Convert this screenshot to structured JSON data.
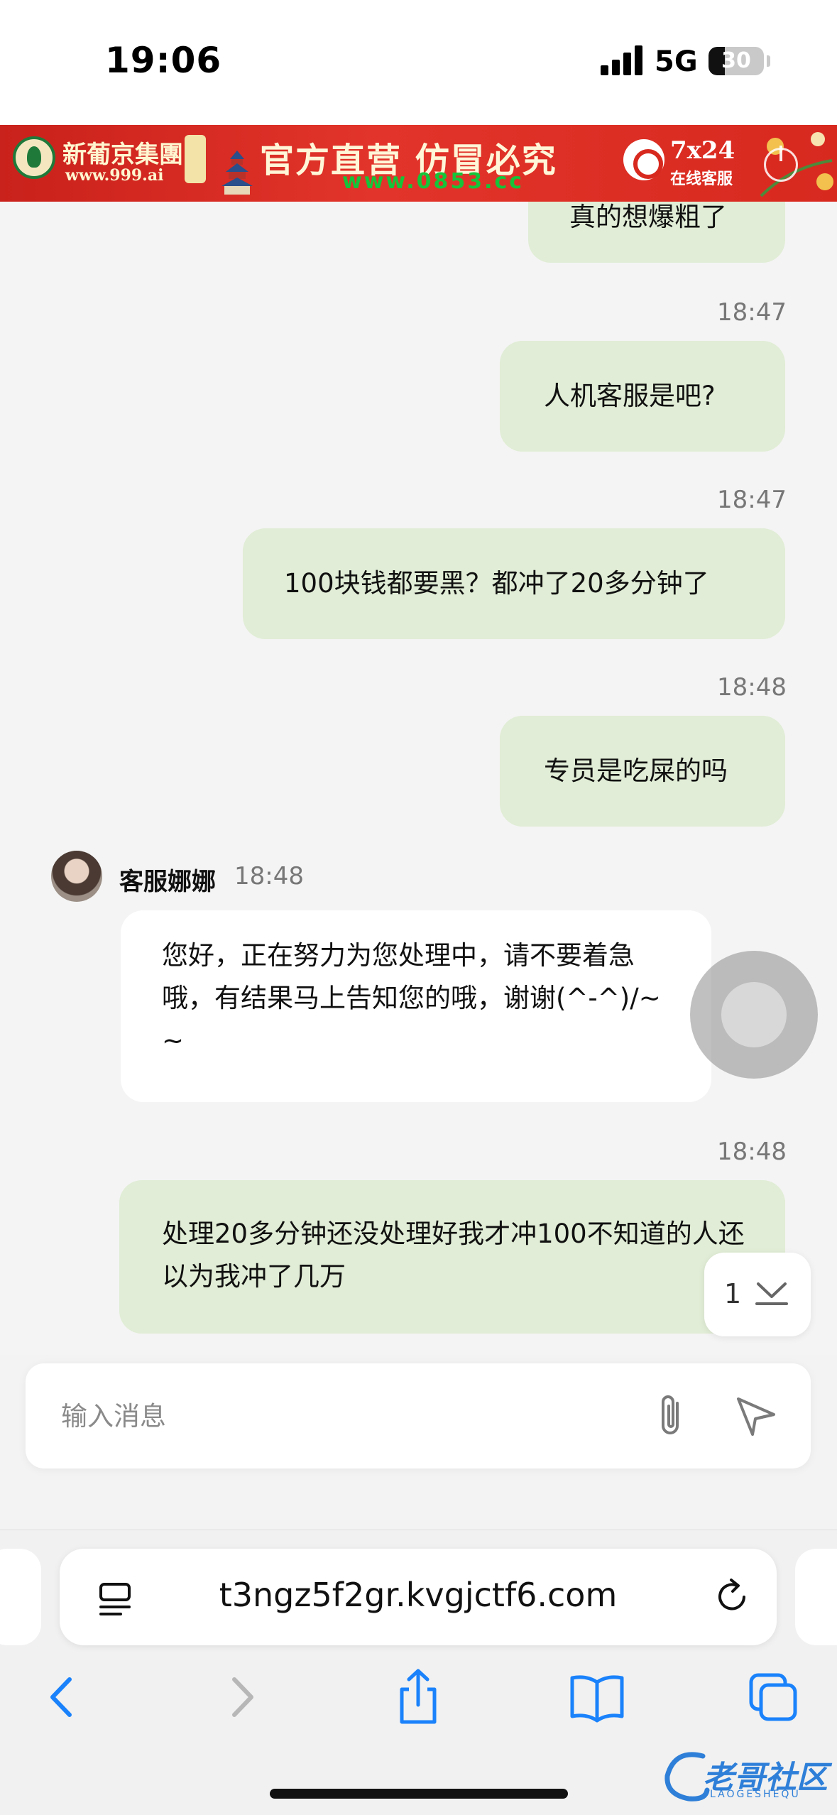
{
  "status_bar": {
    "time": "19:06",
    "network": "5G",
    "battery": "30",
    "battery_level": 0.3
  },
  "ad": {
    "brand": "新葡京集團",
    "brand_url": "www.999.ai",
    "slogan": "官方直营  仿冒必究",
    "url": "www.0853.cc",
    "hours": "7x24",
    "support_label": "在线客服"
  },
  "chat": {
    "messages": [
      {
        "direction": "out",
        "text": "真的想爆粗了"
      },
      {
        "direction": "out",
        "time": "18:47",
        "text": "人机客服是吧?"
      },
      {
        "direction": "out",
        "time": "18:47",
        "text": "100块钱都要黑？都冲了20多分钟了"
      },
      {
        "direction": "out",
        "time": "18:48",
        "text": "专员是吃屎的吗"
      },
      {
        "direction": "in",
        "sender": "客服娜娜",
        "time": "18:48",
        "text": "您好，正在努力为您处理中，请不要着急哦，有结果马上告知您的哦，谢谢(^-^)/~~"
      },
      {
        "direction": "out",
        "time": "18:48",
        "text": "处理20多分钟还没处理好我才冲100不知道的人还以为我冲了几万"
      }
    ],
    "new_count": "1"
  },
  "input": {
    "placeholder": "输入消息",
    "value": ""
  },
  "browser": {
    "url": "t3ngz5f2gr.kvgjctf6.com"
  },
  "watermark": {
    "text": "老哥社区",
    "sub": "LAOGESHEQU"
  },
  "colors": {
    "outgoing_bubble": "#e1edd6",
    "incoming_bubble": "#ffffff",
    "ad_red": "#d8291f",
    "safari_blue": "#1a82fb"
  }
}
